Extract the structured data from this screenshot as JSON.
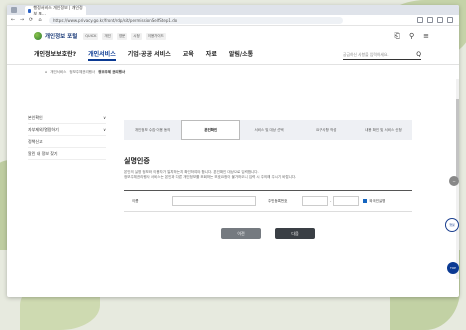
{
  "browser": {
    "tab_title": "행정서비스 개인정보 | 개인정보 포...",
    "url": "https://www.privacy.go.kr/front/rdp/sit/permissionSelfStep1.do",
    "back": "←",
    "forward": "→",
    "reload": "⟳",
    "home": "⌂"
  },
  "site": {
    "logo_text": "개인정보 포털",
    "top_links": [
      "QUICK",
      "개인",
      "영문",
      "시청",
      "이용가이드"
    ],
    "icons": {
      "gift": "⎗",
      "user": "⚲",
      "menu": "≡"
    }
  },
  "nav": {
    "items": [
      "개인정보보호란?",
      "개인서비스",
      "기업·공공 서비스",
      "교육",
      "자료",
      "알림/소통"
    ],
    "search_placeholder": "궁금하신 사항을 입력하세요.",
    "search_icon": "Q"
  },
  "breadcrumb": [
    "⌂",
    "개인서비스",
    "정보주체권리행사",
    "정보주체 권리행사"
  ],
  "sidebar": {
    "items": [
      "본인확인",
      "자부제외/열람하기",
      "정책신고",
      "알린 내 정보 찾기"
    ],
    "arrows": [
      "∨",
      "∨"
    ]
  },
  "steps": [
    "개인정보 수집·이용 동의",
    "본인확인",
    "서비스 및 대상 선택",
    "요구사항 작성",
    "내용 확인 및 서비스 신청"
  ],
  "page": {
    "title": "실명인증",
    "desc1": "본인의 실명 정보와 이용자가 일치하는지 확인하여야 합니다. 본인확인 대상으로 입력합니다.",
    "desc2": "정보주체권리행사 서비스는 본인과 다른 개인정보를 조회하는 보호요청이 불가하오니 입력 시 주의해 주시기 바랍니다."
  },
  "form": {
    "name_label": "이름",
    "rrn_label": "주민등록번호",
    "check_label": "외국인실명"
  },
  "buttons": {
    "prev": "이전",
    "next": "다음"
  },
  "floating": {
    "minus": "−",
    "chat_label": "챗봇",
    "top": "TOP"
  }
}
